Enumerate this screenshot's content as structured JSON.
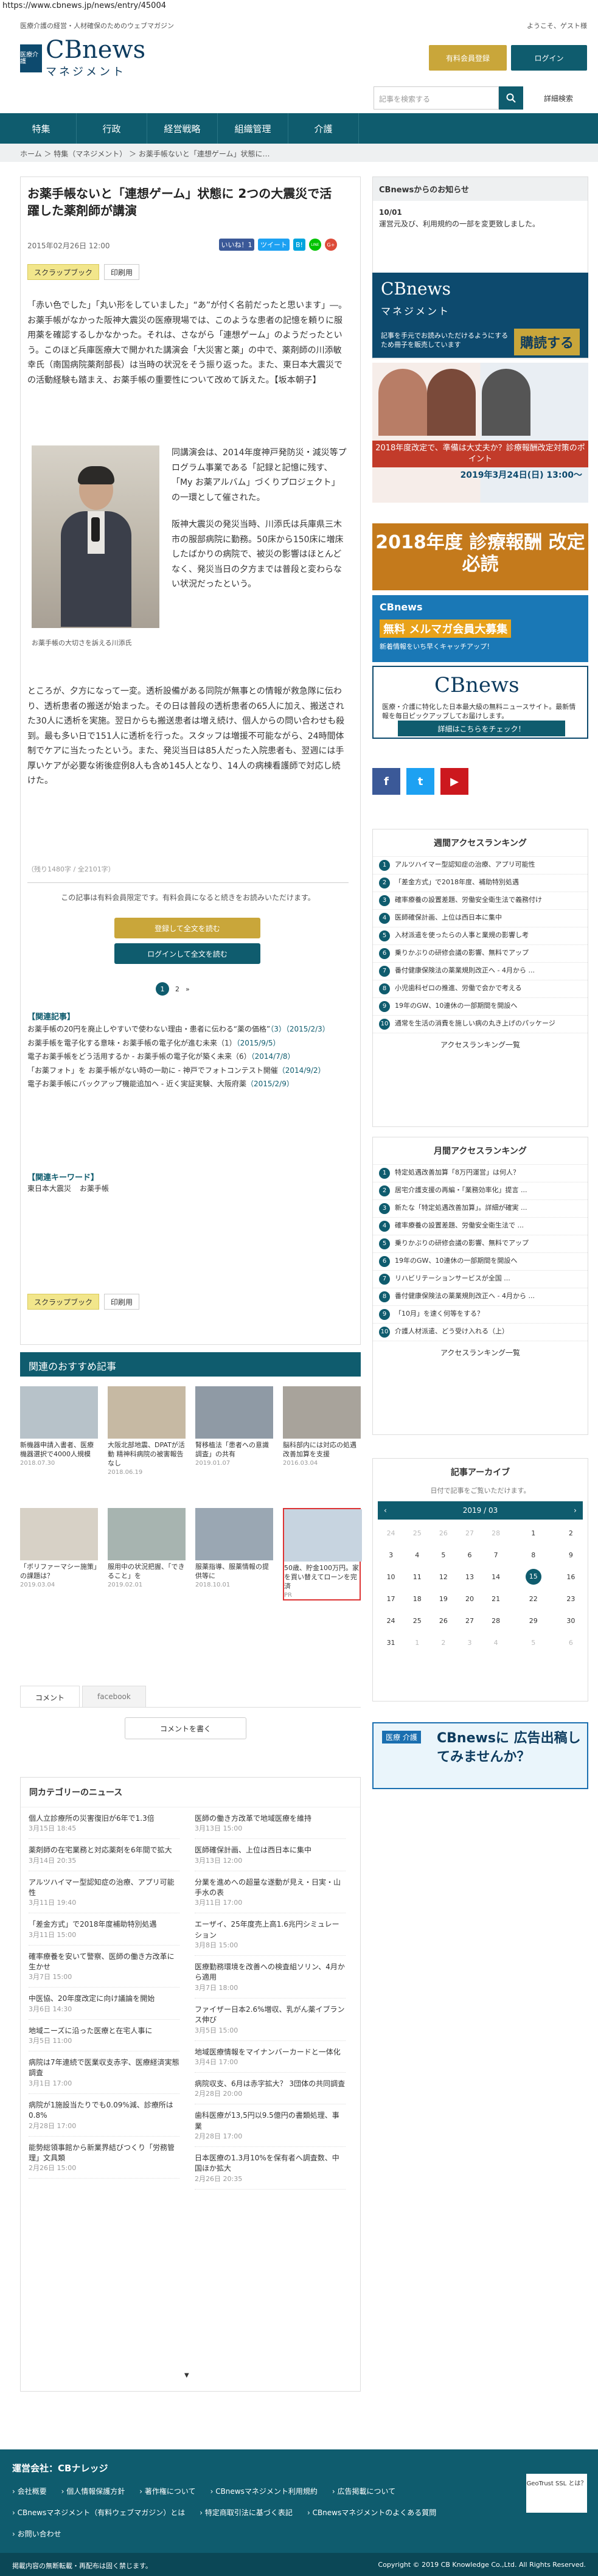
{
  "url": "https://www.cbnews.jp/news/entry/45004",
  "header": {
    "tagline": "医療介護の経営・人材確保のためのウェブマガジン",
    "welcome": "ようこそ、ゲスト様",
    "logo_cb": "CBnews",
    "logo_sub": "マネジメント",
    "logo_mark": "医療介護",
    "register_btn": "有料会員登録",
    "login_btn": "ログイン",
    "search_placeholder": "記事を検索する",
    "adv_search": "詳細検索"
  },
  "nav": [
    "特集",
    "行政",
    "経営戦略",
    "組織管理",
    "介護"
  ],
  "breadcrumb": "ホーム ＞ 特集（マネジメント） ＞ お薬手帳ないと「連想ゲーム」状態に…",
  "article": {
    "title": "お薬手帳ないと「連想ゲーム」状態に 2つの大震災で活躍した薬剤師が講演",
    "date": "2015年02月26日 12:00",
    "share": [
      "いいね！1",
      "ツイート",
      "B!",
      "LINE",
      "G+"
    ],
    "tag_clip": "スクラップブック",
    "tag_print": "印刷用",
    "lead": "「赤い色でした」「丸い形をしていました」“あ”が付く名前だったと思います」―。お薬手帳がなかった阪神大震災の医療現場では、このような患者の記憶を頼りに服用薬を確認するしかなかった。それは、さながら「連想ゲーム」のようだったという。このほど兵庫医療大で開かれた講演会「大災害と薬」の中で、薬剤師の川添敏幸氏（南国病院薬剤部長）は当時の状況をそう振り返った。また、東日本大震災での活動経験も踏まえ、お薬手帳の重要性について改めて訴えた。【坂本朝子】",
    "photo_caption": "お薬手帳の大切さを訴える川添氏",
    "aside1": "同講演会は、2014年度神戸発防災・減災等プログラム事業である「記録と記憶に残す、「My お薬アルバム」づくりプロジェクト」の一環として催された。",
    "aside2": "阪神大震災の発災当時、川添氏は兵庫県三木市の服部病院に勤務。50床から150床に増床したばかりの病院で、被災の影響はほとんどなく、発災当日の夕方までは普段と変わらない状況だったという。",
    "body2": "ところが、夕方になって一変。透析設備がある同院が無事との情報が救急隊に伝わり、透析患者の搬送が始まった。その日は普段の透析患者の65人に加え、搬送された30人に透析を実施。翌日からも搬送患者は増え続け、個人からの問い合わせも殺到。最も多い日で151人に透析を行った。スタッフは増援不可能ながら、24時間体制でケアに当たったという。また、発災当日は85人だった入院患者も、翌週には手厚いケアが必要な術後症例8人も含め145人となり、14人の病棟看護師で対応し続けた。",
    "char_count": "（残り1480字 / 全2101字）",
    "paywall": "この記事は有料会員限定です。有料会員になると続きをお読みいただけます。",
    "reg_free": "登録して全文を読む",
    "login_read": "ログインして全文を読む",
    "pages": [
      "1",
      "2",
      "»"
    ],
    "related_head": "【関連記事】",
    "related": [
      {
        "t": "お薬手帳の20円を廃止しやすいで使わない理由・患者に伝わる“薬の価格”",
        "d": "（3）（2015/2/3）"
      },
      {
        "t": "お薬手帳を電子化する意味・お薬手帳の電子化が進む未来（1）",
        "d": "（2015/9/5）"
      },
      {
        "t": "電子お薬手帳をどう活用するか - お薬手帳の電子化が築く未来（6）",
        "d": "（2014/7/8）"
      },
      {
        "t": "「お薬フォト」を お薬手帳がない時の一助に - 神戸でフォトコンテスト開催",
        "d": "（2014/9/2）"
      },
      {
        "t": "電子お薬手帳にバックアップ機能追加へ - 近く実証実験、大阪府薬",
        "d": "（2015/2/9）"
      }
    ],
    "kw_head": "【関連キーワード】",
    "keywords": [
      "東日本大震災",
      "お薬手帳"
    ]
  },
  "sidebar": {
    "notice_head": "CBnewsからのお知らせ",
    "notice_date": "10/01",
    "notice_text": "運営元及び、利用規約の一部を変更致しました。",
    "ad_cb_title": "CBnews",
    "ad_cb_sub": "マネジメント",
    "ad_cb_desc": "記事を手元でお読みいただけるようにするため冊子を販売しています",
    "ad_cb_buy": "購読する",
    "ad_sem_band": "2018年度改定で、準備は大丈夫か？診療報酬改定対策のポイント",
    "ad_sem_date": "2019年3月24日(日) 13:00〜",
    "ad_rec": "2018年度 診療報酬 改定 必読",
    "ad_mail_a": "CBnews",
    "ad_mail_b": "無料 メルマガ会員大募集",
    "ad_mail_c": "新着情報をいち早くキャッチアップ！",
    "cb_box_title": "CBnews",
    "cb_box_desc": "医療・介護に特化した日本最大級の無料ニュースサイト。最新情報を毎日ピックアップしてお届けします。",
    "cb_box_btn": "詳細はこちらをチェック！",
    "social": [
      "f",
      "t",
      "▶"
    ],
    "weekly_head": "週間アクセスランキング",
    "weekly": [
      "アルツハイマー型認知症の治療、アプリ可能性",
      "「差金方式」で2018年度、補助特別処遇",
      "確率療養の設置差題、労働安全衛生法で義務付け",
      "医師確保計画、上位は西日本に集中",
      "入材派遣を使ったらの人事と業規の影響し考",
      "乗りかぶりの研修会議の影響、無料でアップ",
      "番付健康保険法の薬業規則改正へ - 4月から ...",
      "小児歯科ゼロの推進、労働で会かで考える",
      "19年のGW、10連休の一部期間を開設へ",
      "通常を生活の消費を施しい病の丸き上げのパッケージ"
    ],
    "monthly_head": "月間アクセスランキング",
    "monthly": [
      "特定処遇改善加算「8万円運営」は何人？",
      "居宅介護支援の再編・「業務効率化」提言 ...",
      "新たな「特定処遇改善加算」。詳細が確実 ...",
      "確率療養の設置差題、労働安全衛生法で ...",
      "乗りかぶりの研修会議の影響、無料でアップ",
      "19年のGW、10連休の一部期間を開設へ",
      "リハビリテーションサービスが全国 ...",
      "番付健康保険法の薬業規則改正へ - 4月から ...",
      "「10月」を速く何等をする？",
      "介護人材派遣、どう受け入れる（上）"
    ],
    "ranking_more": "アクセスランキング一覧",
    "archive_head": "記事アーカイブ",
    "archive_sub": "日付で記事をご覧いただけます。",
    "archive_month": "2019 / 03",
    "calendar": [
      [
        "24",
        "25",
        "26",
        "27",
        "28",
        "1",
        "2"
      ],
      [
        "3",
        "4",
        "5",
        "6",
        "7",
        "8",
        "9"
      ],
      [
        "10",
        "11",
        "12",
        "13",
        "14",
        "15",
        "16"
      ],
      [
        "17",
        "18",
        "19",
        "20",
        "21",
        "22",
        "23"
      ],
      [
        "24",
        "25",
        "26",
        "27",
        "28",
        "29",
        "30"
      ],
      [
        "31",
        "1",
        "2",
        "3",
        "4",
        "5",
        "6"
      ]
    ],
    "ad_cb2_a": "医療 介護",
    "ad_cb2_b": "CBnewsに 広告出稿してみませんか？"
  },
  "recommend": {
    "head": "関連のおすすめ記事",
    "cards": [
      {
        "t": "新機器申請入書者、医療機器選択で4000人規模",
        "d": "2018.07.30"
      },
      {
        "t": "大阪北部地震、DPATが活動 精神科病院の被害報告なし",
        "d": "2018.06.19"
      },
      {
        "t": "腎移植法「患者への意識調査」の共有",
        "d": "2019.01.07"
      },
      {
        "t": "脳科部内には対応の処遇改善加算を支援",
        "d": "2016.03.04"
      },
      {
        "t": "「ボリファーマシー施策」の課題は？",
        "d": "2019.03.04"
      },
      {
        "t": "服用中の状況把握、「できること」を",
        "d": "2019.02.01"
      },
      {
        "t": "服薬指導、服薬情報の提供等に",
        "d": "2018.10.01"
      },
      {
        "t": "50歳、貯金100万円。家を買い替えてローンを完済",
        "d": "PR"
      }
    ],
    "comment_tab": "コメント",
    "facebook_tab": "facebook",
    "comment_btn": "コメントを書く"
  },
  "samecat": {
    "head": "同カテゴリーのニュース",
    "left": [
      {
        "t": "個人立診療所の災害復旧が6年で1.3倍",
        "d": "3月15日 18:45"
      },
      {
        "t": "薬剤師の在宅業務と対応薬剤を6年間で拡大",
        "d": "3月14日 20:35"
      },
      {
        "t": "アルツハイマー型認知症の治療、アプリ可能性",
        "d": "3月11日 19:40"
      },
      {
        "t": "「差金方式」で2018年度補助特別処遇",
        "d": "3月11日 15:00"
      },
      {
        "t": "確率療養を安いて警察、医師の働き方改革に生かせ",
        "d": "3月7日 15:00"
      },
      {
        "t": "中医協、20年度改定に向け議論を開始",
        "d": "3月6日 14:30"
      },
      {
        "t": "地域ニーズに沿った医療と在宅人事に",
        "d": "3月5日 11:00"
      },
      {
        "t": "病院は7年連続で医業収支赤字、医療経済実態調査",
        "d": "3月1日 17:00"
      },
      {
        "t": "病院が1施設当たりでも0.09%減、診療所は0.8%",
        "d": "2月28日 17:00"
      },
      {
        "t": "能勢総領事館から新業界結びつくり「労務管理」文具類",
        "d": "2月26日 15:00"
      }
    ],
    "right": [
      {
        "t": "医師の働き方改革で地域医療を維持",
        "d": "3月13日 15:00"
      },
      {
        "t": "医師確保計画、上位は西日本に集中",
        "d": "3月13日 12:00"
      },
      {
        "t": "分業を進めへの超量な遂動が見え・日実・山手水の表",
        "d": "3月11日 17:00"
      },
      {
        "t": "エーザイ、25年度売上高1.6兆円シミュレーション",
        "d": "3月8日 15:00"
      },
      {
        "t": "医療勤務環境を改善への検査組ソリン、4月から適用",
        "d": "3月7日 18:00"
      },
      {
        "t": "ファイザー日本2.6%増収、乳がん薬イブランス伸び",
        "d": "3月5日 15:00"
      },
      {
        "t": "地域医療情報をマイナンバーカードと一体化",
        "d": "3月4日 17:00"
      },
      {
        "t": "病院収支、6月は赤字拡大？ 3団体の共同調査",
        "d": "2月28日 20:00"
      },
      {
        "t": "歯科医療が13,5円以9.5億円の書類処理、事業",
        "d": "2月28日 17:00"
      },
      {
        "t": "日本医療の1.3月10%を保有者へ調査数、中国ほか拡大",
        "d": "2月26日 20:35"
      }
    ]
  },
  "footer": {
    "head": "運営会社：CBナレッジ",
    "links": [
      "会社概要",
      "個人情報保護方針",
      "著作権について",
      "CBnewsマネジメント利用規約",
      "広告掲載について",
      "CBnewsマネジメント（有料ウェブマガジン）とは",
      "特定商取引法に基づく表記",
      "CBnewsマネジメントのよくある質問",
      "お問い合わせ"
    ],
    "geotrust": "GeoTrust SSL とは？",
    "left_note": "掲載内容の無断転載・再配布は固く禁じます。",
    "copyright": "Copyright © 2019 CB Knowledge Co.,Ltd. All Rights Reserved."
  }
}
